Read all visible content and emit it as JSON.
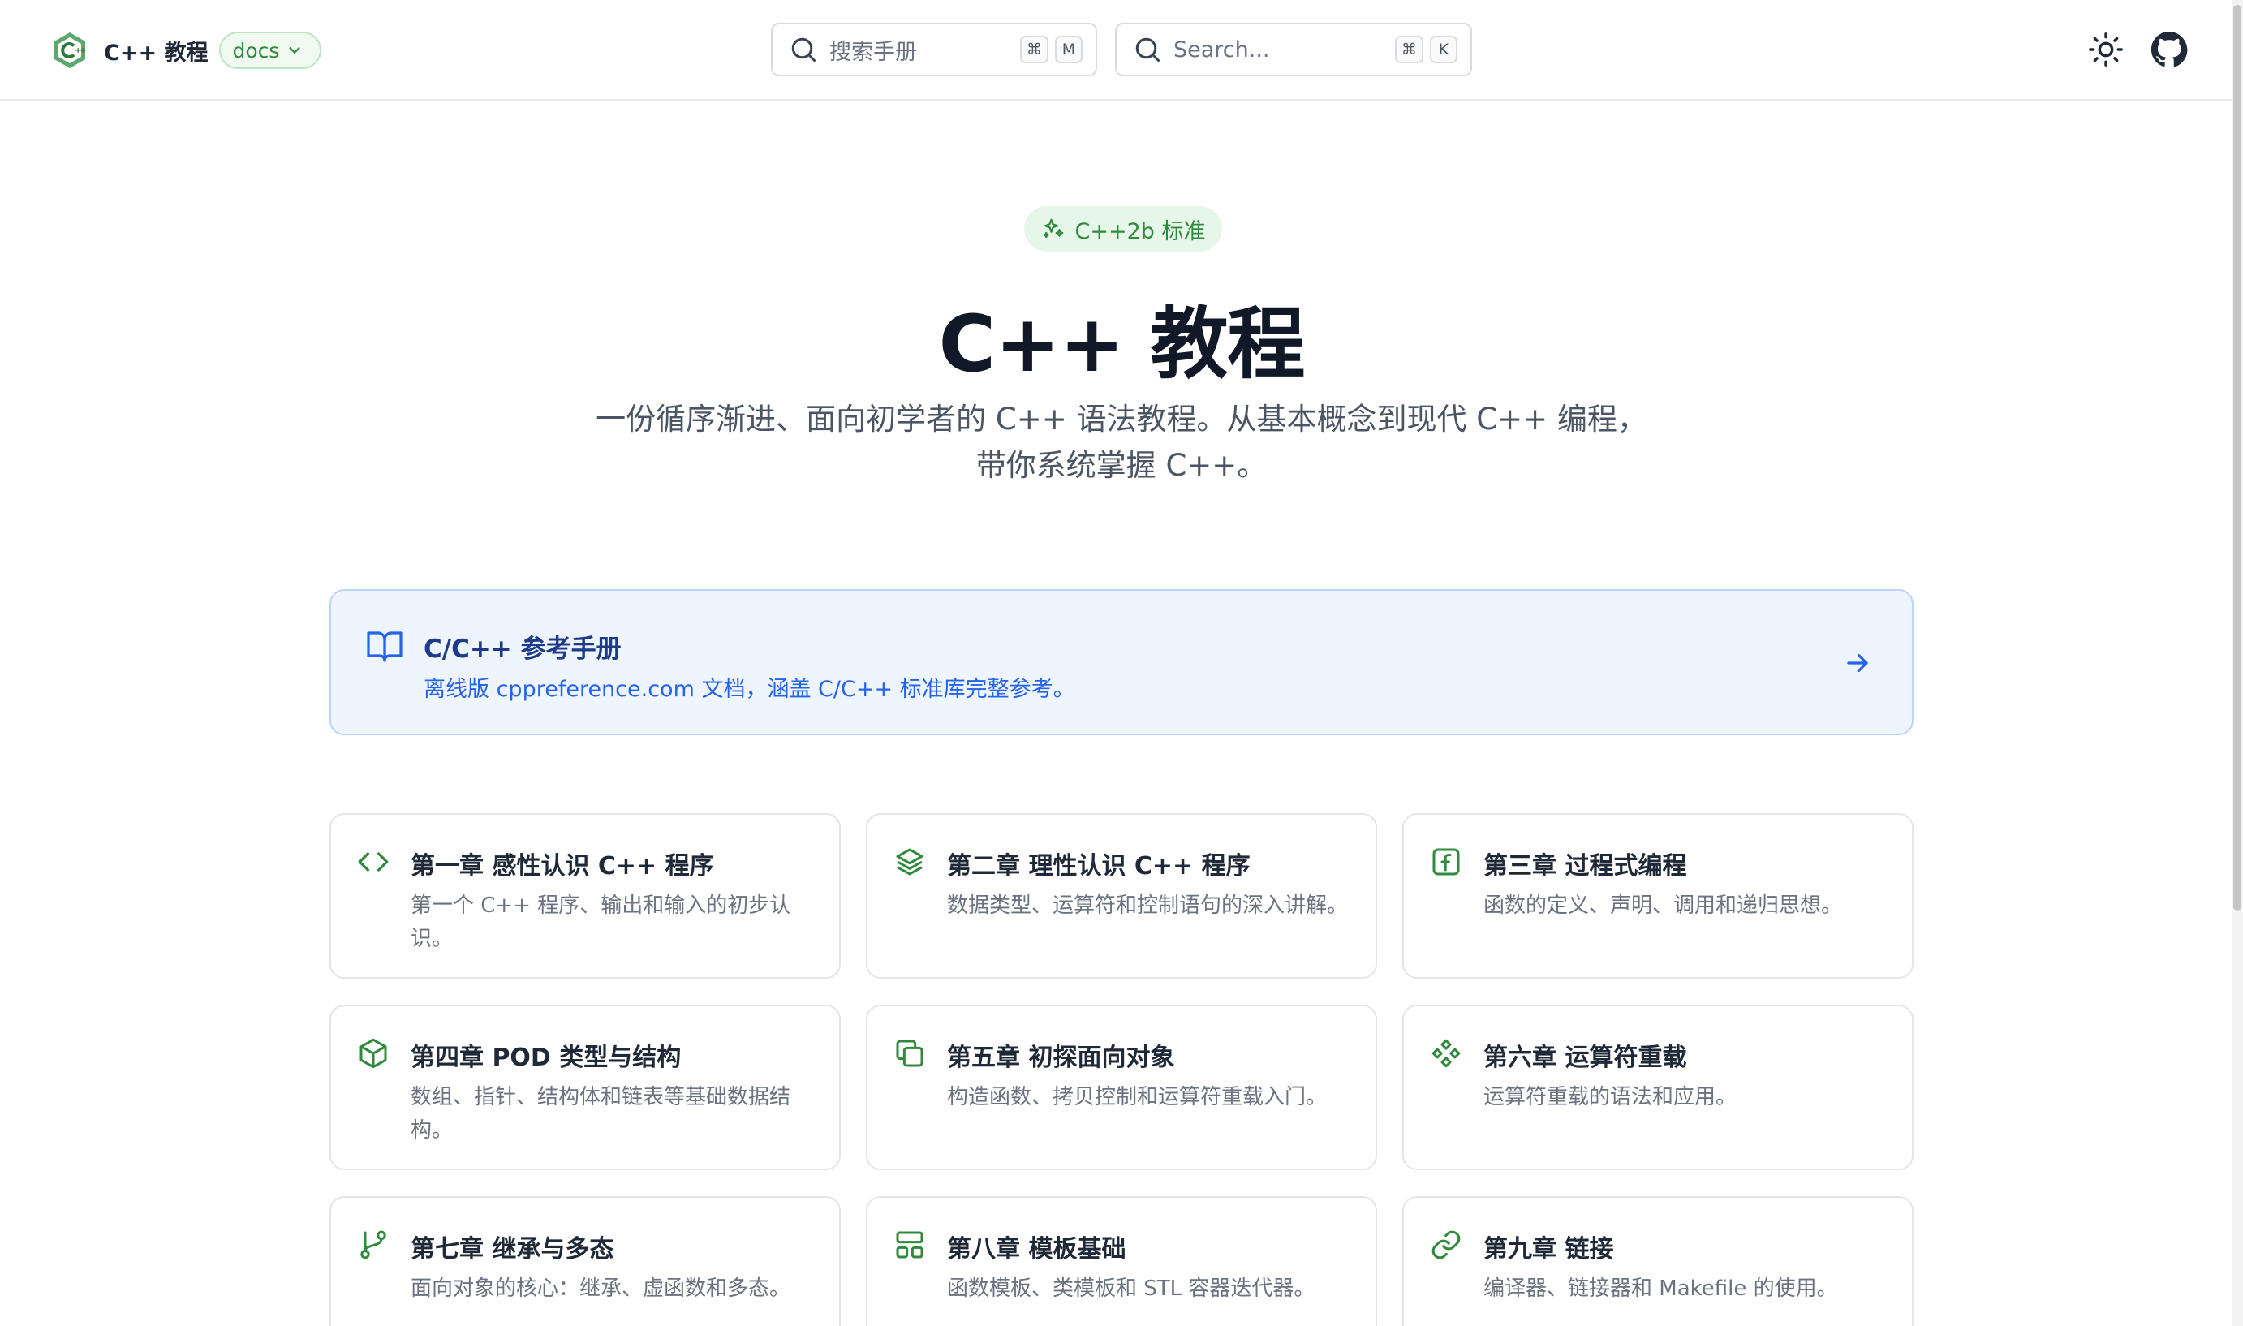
{
  "header": {
    "site_title": "C++ 教程",
    "version_label": "docs",
    "manual_search": {
      "placeholder": "搜索手册",
      "keys": [
        "⌘",
        "M"
      ]
    },
    "site_search": {
      "placeholder": "Search...",
      "keys": [
        "⌘",
        "K"
      ]
    },
    "icons": {
      "theme": "sun-icon",
      "repo": "github-icon",
      "logo": "cpp-logo-icon"
    }
  },
  "hero": {
    "badge": "C++2b 标准",
    "title": "C++ 教程",
    "description": "一份循序渐进、面向初学者的 C++ 语法教程。从基本概念到现代 C++ 编程，带你系统掌握 C++。"
  },
  "reference": {
    "title": "C/C++ 参考手册",
    "description": "离线版 cppreference.com 文档，涵盖 C/C++ 标准库完整参考。"
  },
  "chapters": [
    {
      "title": "第一章 感性认识 C++ 程序",
      "description": "第一个 C++ 程序、输出和输入的初步认识。",
      "icon": "code-icon"
    },
    {
      "title": "第二章 理性认识 C++ 程序",
      "description": "数据类型、运算符和控制语句的深入讲解。",
      "icon": "layers-icon"
    },
    {
      "title": "第三章 过程式编程",
      "description": "函数的定义、声明、调用和递归思想。",
      "icon": "function-icon"
    },
    {
      "title": "第四章 POD 类型与结构",
      "description": "数组、指针、结构体和链表等基础数据结构。",
      "icon": "box-icon"
    },
    {
      "title": "第五章 初探面向对象",
      "description": "构造函数、拷贝控制和运算符重载入门。",
      "icon": "copy-icon"
    },
    {
      "title": "第六章 运算符重载",
      "description": "运算符重载的语法和应用。",
      "icon": "component-icon"
    },
    {
      "title": "第七章 继承与多态",
      "description": "面向对象的核心：继承、虚函数和多态。",
      "icon": "git-branch-icon"
    },
    {
      "title": "第八章 模板基础",
      "description": "函数模板、类模板和 STL 容器迭代器。",
      "icon": "layout-icon"
    },
    {
      "title": "第九章 链接",
      "description": "编译器、链接器和 Makefile 的使用。",
      "icon": "link-icon"
    }
  ],
  "colors": {
    "accent_green": "#2f8a3c",
    "reference_blue": "#2563eb",
    "reference_bg": "#eef5ff",
    "text_dark": "#111827",
    "text_muted": "#6b7280"
  }
}
